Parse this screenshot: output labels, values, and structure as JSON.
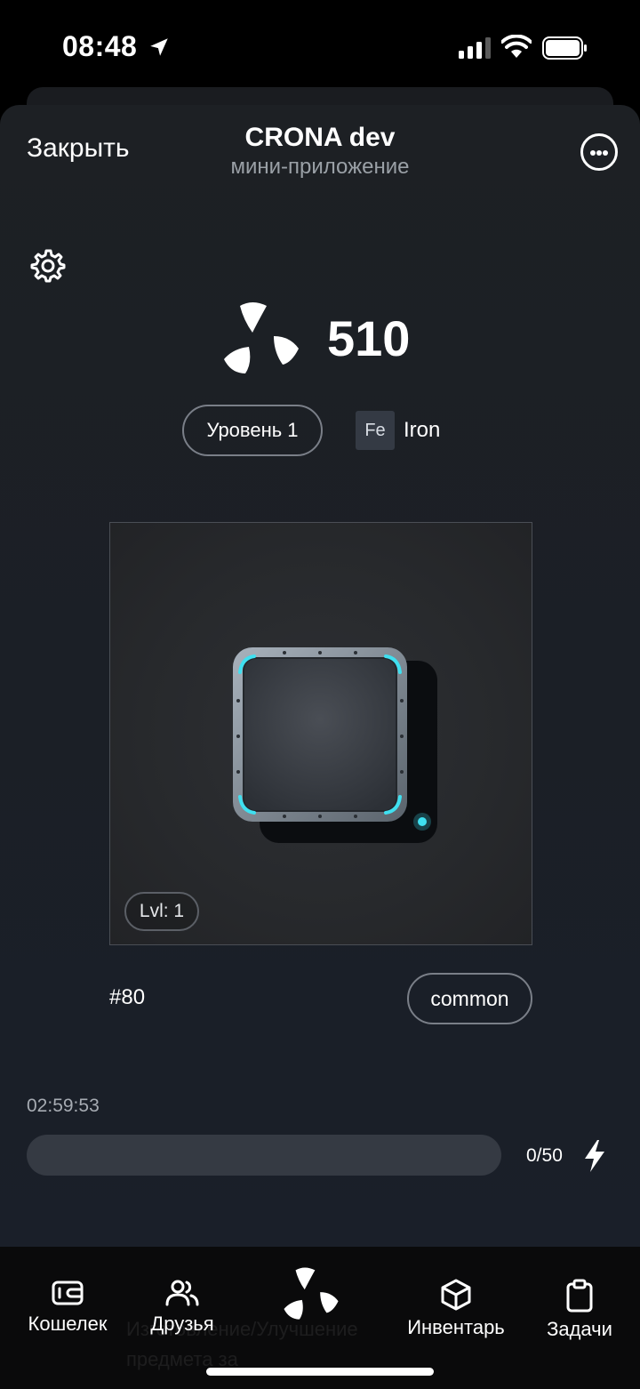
{
  "status_bar": {
    "time": "08:48",
    "icons": [
      "location-arrow-icon",
      "signal-icon",
      "wifi-icon",
      "battery-icon"
    ]
  },
  "header": {
    "close_label": "Закрыть",
    "title": "CRONA dev",
    "subtitle": "мини-приложение",
    "more_icon": "more-options-icon"
  },
  "main": {
    "settings_icon": "gear-icon",
    "logo_icon": "crona-logo-icon",
    "balance": "510",
    "level_label": "Уровень 1",
    "element_symbol": "Fe",
    "element_name": "Iron",
    "item": {
      "level_badge": "Lvl: 1",
      "id": "#80",
      "rarity": "common",
      "accent_color": "#3fe0f0"
    },
    "timer": "02:59:53",
    "energy": {
      "current": 0,
      "max": 50,
      "label": "0/50",
      "fraction": 0,
      "bolt_icon": "lightning-icon"
    }
  },
  "nav": {
    "items": [
      {
        "label": "Кошелек",
        "icon": "wallet-icon"
      },
      {
        "label": "Друзья",
        "icon": "users-icon"
      },
      {
        "label": "",
        "icon": "crona-logo-icon"
      },
      {
        "label": "Инвентарь",
        "icon": "cube-icon"
      },
      {
        "label": "Задачи",
        "icon": "clipboard-icon"
      }
    ],
    "ghost_text": "Изготовление/Улучшение предмета за"
  },
  "colors": {
    "background": "#1b1f26",
    "accent": "#3fe0f0",
    "pill_border": "#7a7f88"
  }
}
